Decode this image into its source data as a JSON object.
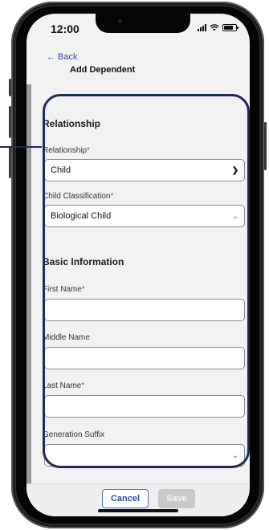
{
  "status_bar": {
    "time": "12:00"
  },
  "nav": {
    "back_label": "← Back",
    "title": "Add Dependent"
  },
  "form": {
    "relationship_section": "Relationship",
    "relationship_label": "Relationship",
    "relationship_value": "Child",
    "classification_label": "Child Classification",
    "classification_value": "Biological Child",
    "basic_section": "Basic Information",
    "first_name_label": "First Name",
    "middle_name_label": "Middle Name",
    "last_name_label": "Last Name",
    "suffix_label": "Generation Suffix",
    "required_mark": "*"
  },
  "footer": {
    "cancel_label": "Cancel",
    "save_label": "Save"
  },
  "colors": {
    "accent": "#2a4fa8",
    "highlight_border": "#1d2a5c",
    "required": "#c0392b"
  },
  "icons": [
    "signal-icon",
    "wifi-icon",
    "battery-icon",
    "chevron-down-icon"
  ]
}
